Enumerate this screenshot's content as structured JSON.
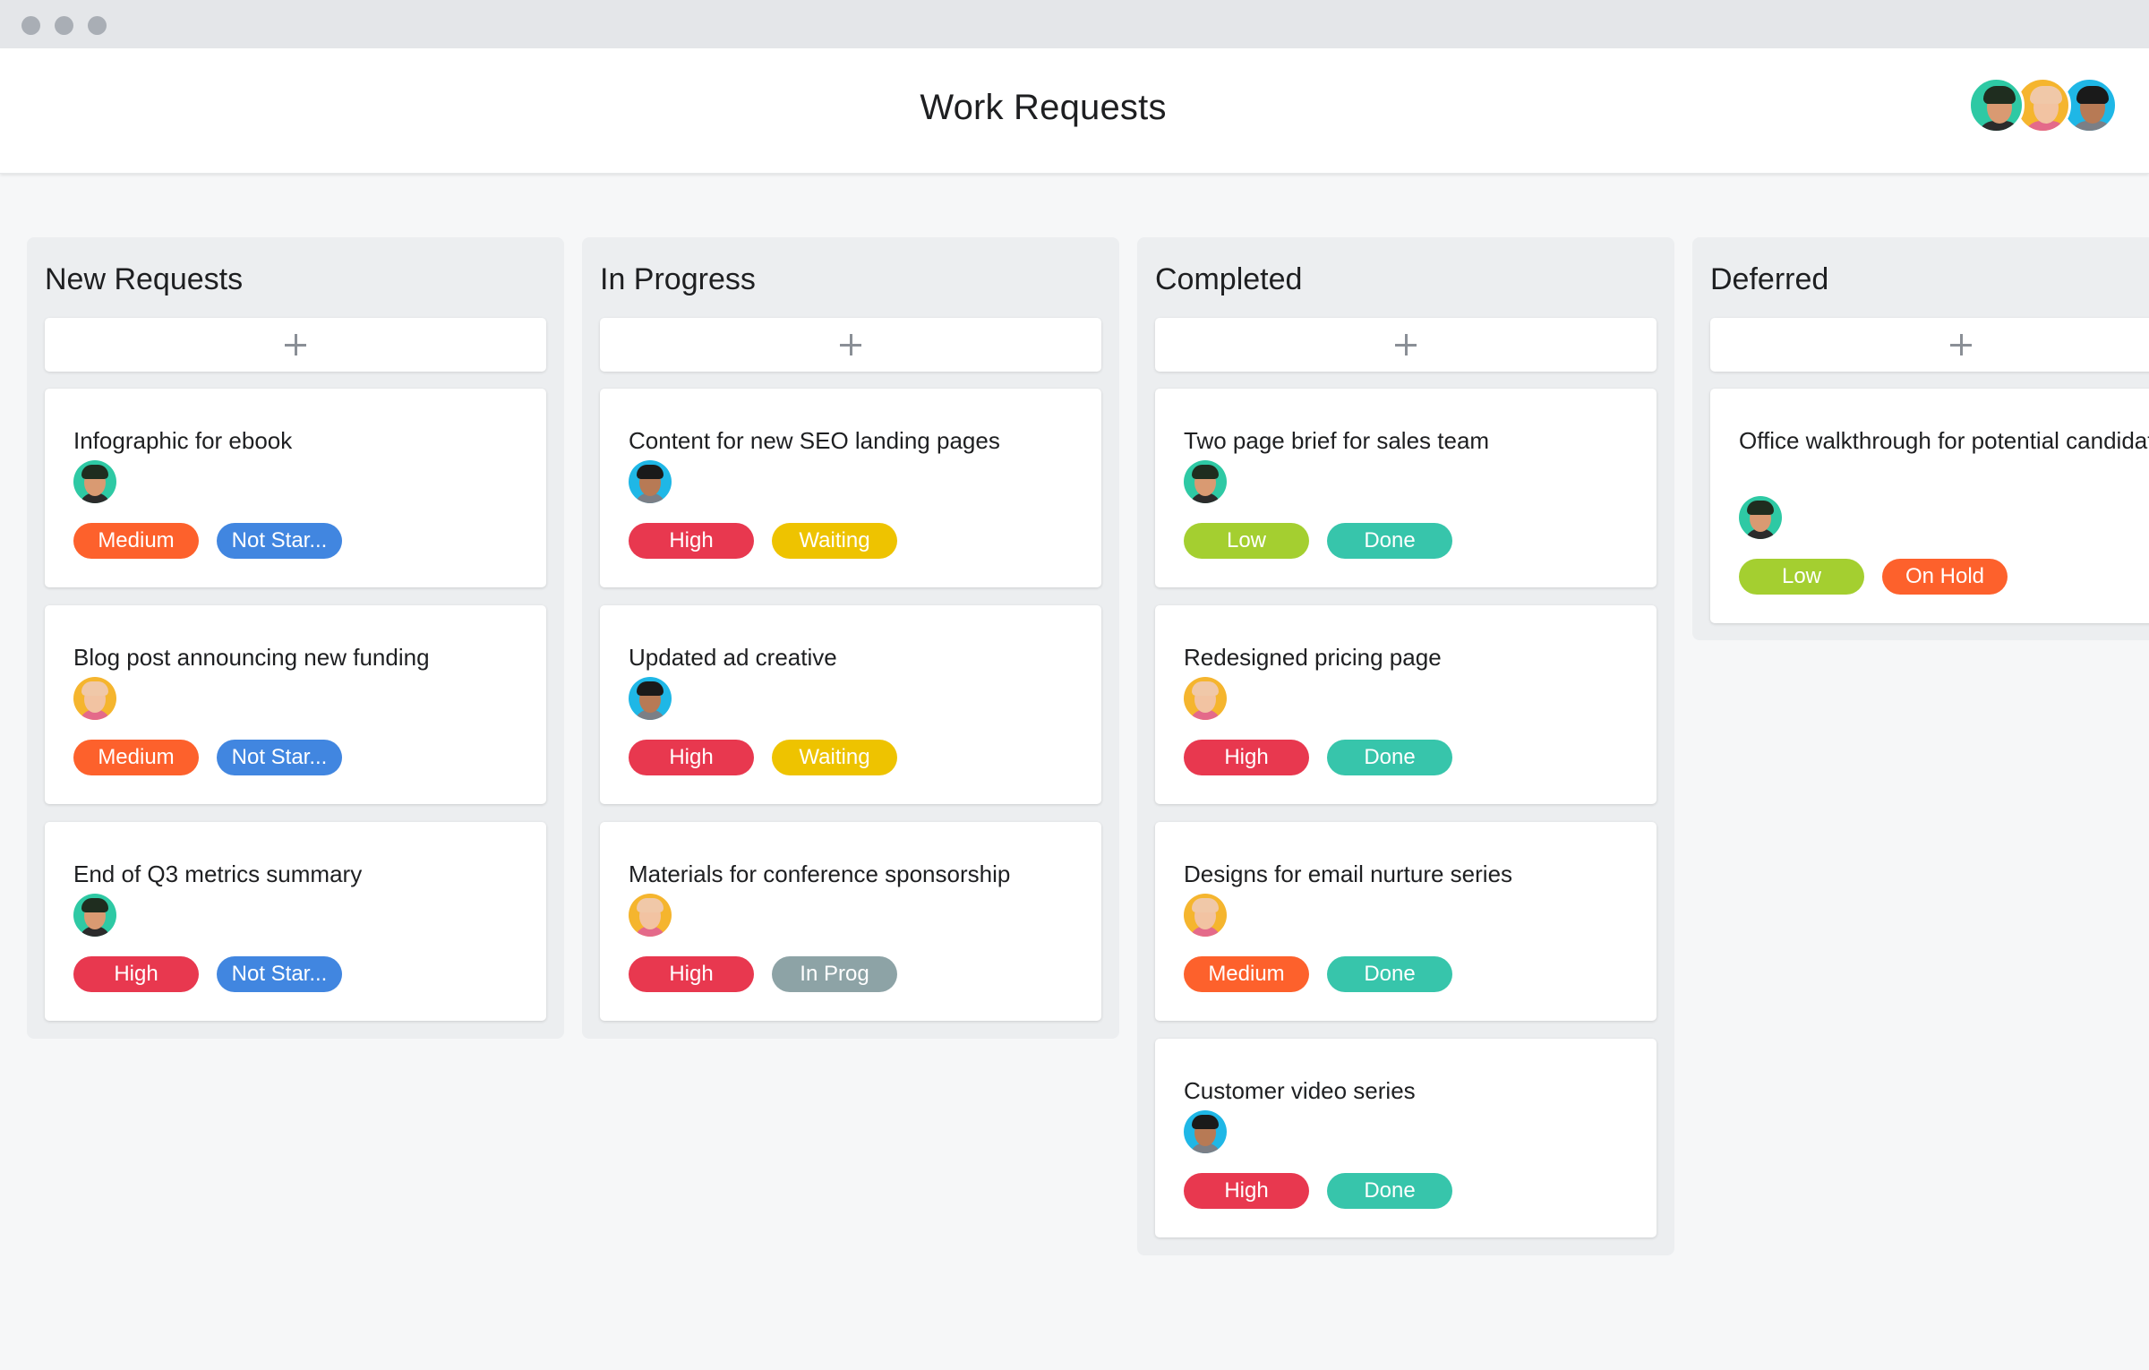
{
  "page": {
    "title": "Work Requests"
  },
  "members": [
    {
      "name": "member-1",
      "bg": "#2ec9a4",
      "hair": "#1f2d1f",
      "shirt": "#2b2b2b",
      "skin": "#d99a72"
    },
    {
      "name": "member-2",
      "bg": "#f5b52e",
      "hair": "#f0c8a8",
      "shirt": "#e46a8a",
      "skin": "#f2c3a2"
    },
    {
      "name": "member-3",
      "bg": "#1fb7e6",
      "hair": "#1a1a1a",
      "shirt": "#7b7f86",
      "skin": "#b77a55"
    }
  ],
  "colors": {
    "Medium": "#fd612c",
    "High": "#e8384f",
    "Low": "#a4cf30",
    "Not Star...": "#4186e0",
    "Waiting": "#eec300",
    "Done": "#37c5ab",
    "In Prog": "#8da3a6",
    "On Hold": "#fd612c"
  },
  "columns": [
    {
      "title": "New Requests",
      "cards": [
        {
          "title": "Infographic for ebook",
          "assignee": 0,
          "priority": "Medium",
          "status": "Not Star..."
        },
        {
          "title": "Blog post announcing new funding",
          "assignee": 1,
          "priority": "Medium",
          "status": "Not Star..."
        },
        {
          "title": "End of Q3 metrics summary",
          "assignee": 0,
          "priority": "High",
          "status": "Not Star..."
        }
      ]
    },
    {
      "title": "In Progress",
      "cards": [
        {
          "title": "Content for new SEO landing pages",
          "assignee": 2,
          "priority": "High",
          "status": "Waiting"
        },
        {
          "title": "Updated ad creative",
          "assignee": 2,
          "priority": "High",
          "status": "Waiting"
        },
        {
          "title": "Materials for conference sponsorship",
          "assignee": 1,
          "priority": "High",
          "status": "In Prog"
        }
      ]
    },
    {
      "title": "Completed",
      "cards": [
        {
          "title": "Two page brief for sales team",
          "assignee": 0,
          "priority": "Low",
          "status": "Done"
        },
        {
          "title": "Redesigned pricing page",
          "assignee": 1,
          "priority": "High",
          "status": "Done"
        },
        {
          "title": "Designs for email nurture series",
          "assignee": 1,
          "priority": "Medium",
          "status": "Done"
        },
        {
          "title": "Customer video series",
          "assignee": 2,
          "priority": "High",
          "status": "Done"
        }
      ]
    },
    {
      "title": "Deferred",
      "cards": [
        {
          "title": "Office walkthrough for potential candidates",
          "assignee": 0,
          "priority": "Low",
          "status": "On Hold"
        }
      ]
    }
  ]
}
